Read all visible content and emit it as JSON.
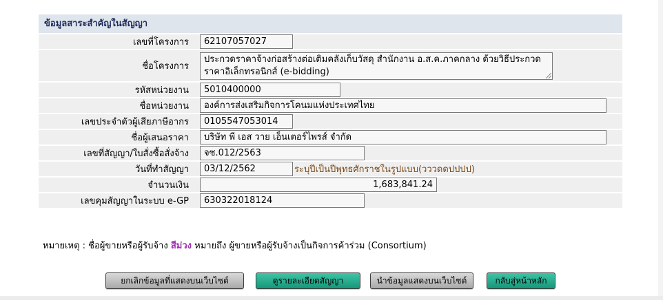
{
  "panel": {
    "title": "ข้อมูลสาระสำคัญในสัญญา"
  },
  "fields": {
    "project_no": {
      "label": "เลขที่โครงการ",
      "value": "62107057027"
    },
    "project_name": {
      "label": "ชื่อโครงการ",
      "value": "ประกวดราคาจ้างก่อสร้างต่อเติมคลังเก็บวัสดุ สำนักงาน อ.ส.ค.ภาคกลาง ด้วยวิธีประกวดราคาอิเล็กทรอนิกส์ (e-bidding)"
    },
    "agency_code": {
      "label": "รหัสหน่วยงาน",
      "value": "5010400000"
    },
    "agency_name": {
      "label": "ชื่อหน่วยงาน",
      "value": "องค์การส่งเสริมกิจการโคนมแห่งประเทศไทย"
    },
    "tax_id": {
      "label": "เลขประจำตัวผู้เสียภาษีอากร",
      "value": "0105547053014"
    },
    "bidder_name": {
      "label": "ชื่อผู้เสนอราคา",
      "value": "บริษัท พี เอส วาย เอ็นเตอร์ไพรส์ จำกัด"
    },
    "contract_no": {
      "label": "เลขที่สัญญา/ใบสั่งซื้อสั่งจ้าง",
      "value": "จซ.012/2563"
    },
    "contract_date": {
      "label": "วันที่ทำสัญญา",
      "value": "03/12/2562",
      "hint": "ระบุปีเป็นปีพุทธศักราชในรูปแบบ(วววดดปปปป)"
    },
    "amount": {
      "label": "จำนวนเงิน",
      "value": "1,683,841.24"
    },
    "egp_control": {
      "label": "เลขคุมสัญญาในระบบ e-GP",
      "value": "630322018124"
    }
  },
  "note": {
    "prefix": "หมายเหตุ : ชื่อผู้ขายหรือผู้รับจ้าง",
    "highlight": "สีม่วง",
    "suffix": "หมายถึง ผู้ขายหรือผู้รับจ้างเป็นกิจการค้าร่วม (Consortium)"
  },
  "buttons": {
    "cancel_publish": "ยกเลิกข้อมูลที่แสดงบนเว็บไซต์",
    "view_contract": "ดูรายละเอียดสัญญา",
    "publish": "นำข้อมูลแสดงบนเว็บไซต์",
    "home": "กลับสู่หน้าหลัก"
  },
  "colors": {
    "panel_header_bg": "#dfe5ec",
    "panel_header_text": "#1f2c5c",
    "row_bg": "#efefef",
    "consortium_highlight": "#9b2fae",
    "date_hint": "#7b4a16",
    "button_gray": "#bdbdbd",
    "button_green": "#21a989"
  }
}
